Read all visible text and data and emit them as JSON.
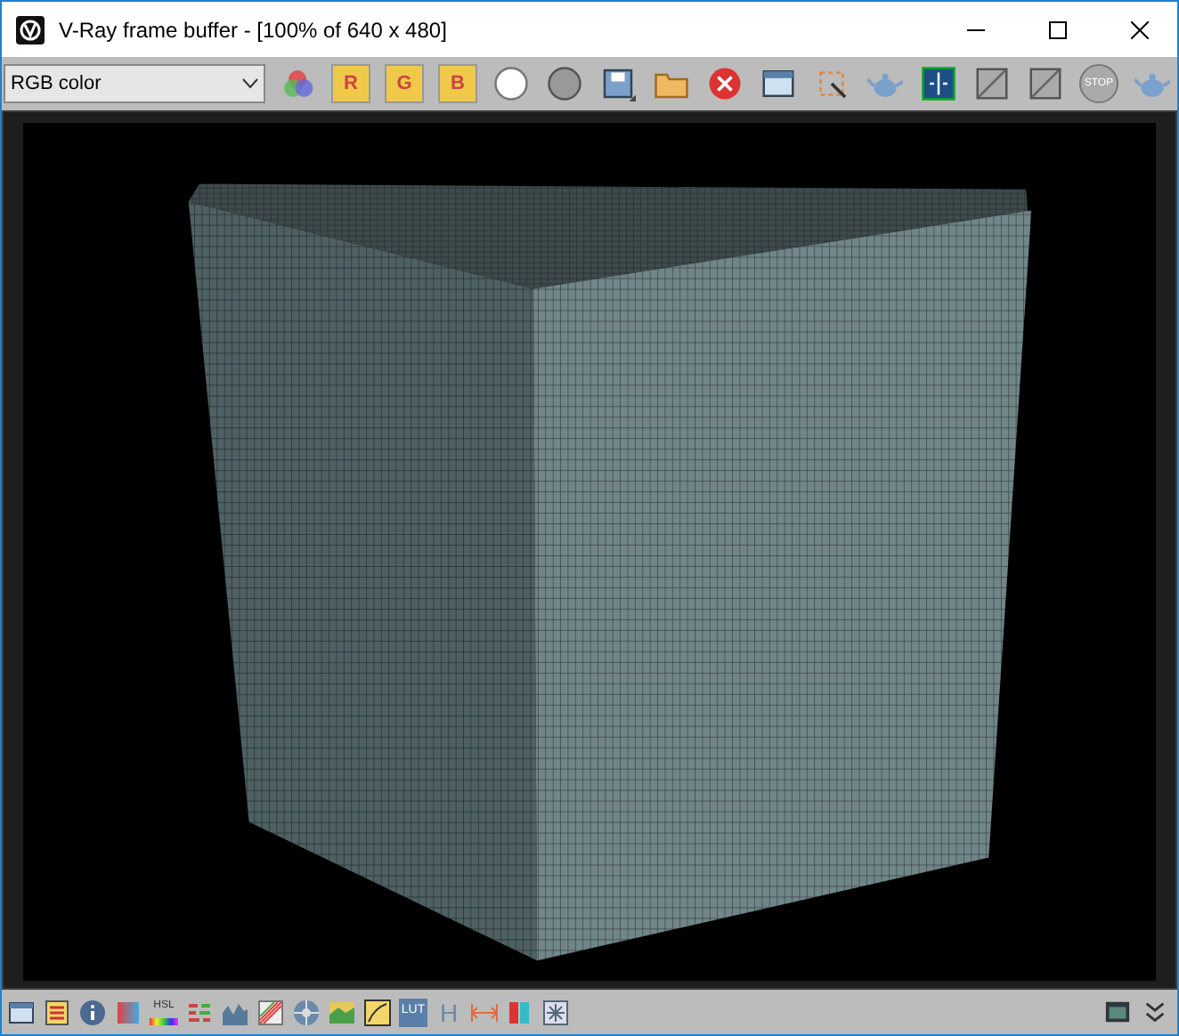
{
  "window": {
    "title": "V-Ray frame buffer - [100% of 640 x 480]"
  },
  "channel_select": {
    "value": "RGB color"
  },
  "toolbar": [
    {
      "kind": "channels"
    },
    {
      "kind": "letter",
      "label": "R",
      "selected": true
    },
    {
      "kind": "letter",
      "label": "G",
      "selected": true
    },
    {
      "kind": "letter",
      "label": "B",
      "selected": true
    },
    {
      "kind": "white-circle"
    },
    {
      "kind": "grey-circle"
    },
    {
      "kind": "save"
    },
    {
      "kind": "folder"
    },
    {
      "kind": "clear"
    },
    {
      "kind": "window"
    },
    {
      "kind": "region"
    },
    {
      "kind": "teapot"
    },
    {
      "kind": "compare"
    },
    {
      "kind": "ab"
    },
    {
      "kind": "ab"
    },
    {
      "kind": "stop",
      "label": "STOP"
    },
    {
      "kind": "teapot"
    }
  ],
  "bottom_toolbar": [
    {
      "kind": "window"
    },
    {
      "kind": "list"
    },
    {
      "kind": "info"
    },
    {
      "kind": "gradient"
    },
    {
      "kind": "hsl",
      "label": "HSL"
    },
    {
      "kind": "bars"
    },
    {
      "kind": "histogram"
    },
    {
      "kind": "curves"
    },
    {
      "kind": "wheel"
    },
    {
      "kind": "landscape"
    },
    {
      "kind": "frame"
    },
    {
      "kind": "lut",
      "label": "LUT"
    },
    {
      "kind": "text",
      "label": "H"
    },
    {
      "kind": "arrows"
    },
    {
      "kind": "split"
    },
    {
      "kind": "burst"
    }
  ],
  "bottom_right": [
    {
      "kind": "panel"
    },
    {
      "kind": "chevrons"
    }
  ]
}
